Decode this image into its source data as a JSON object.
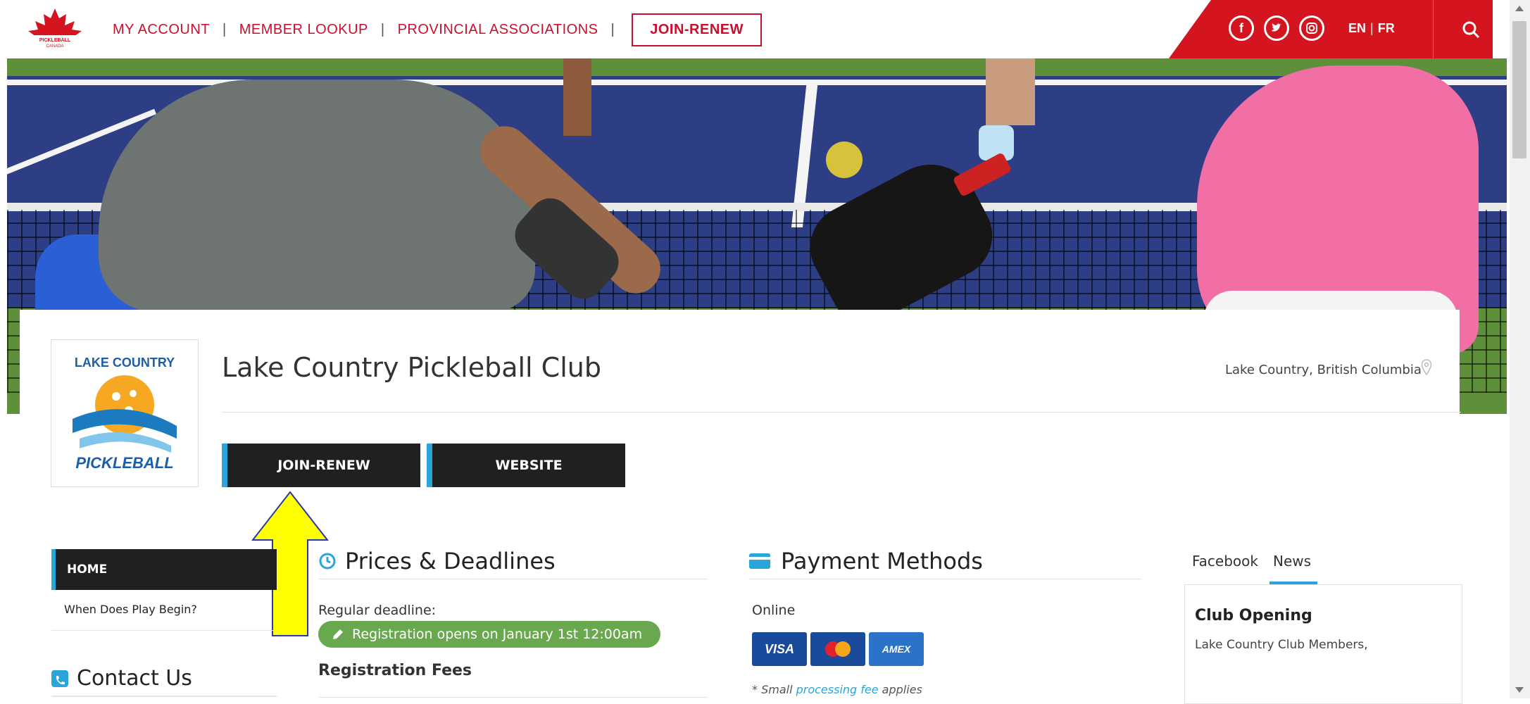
{
  "header": {
    "logo_text": "PICKLEBALL CANADA",
    "nav": [
      "MY ACCOUNT",
      "MEMBER LOOKUP",
      "PROVINCIAL ASSOCIATIONS"
    ],
    "separator": "|",
    "join_label": "JOIN-RENEW",
    "social_icons": [
      "facebook-icon",
      "twitter-icon",
      "instagram-icon"
    ],
    "lang_en": "EN",
    "lang_sep": "|",
    "lang_fr": "FR",
    "search_icon": "search-icon",
    "brand_red": "#d4141f"
  },
  "club": {
    "name": "Lake Country Pickleball Club",
    "location": "Lake Country, British Columbia",
    "logo_top": "LAKE COUNTRY",
    "logo_bottom": "PICKLEBALL",
    "buttons": {
      "join": "JOIN-RENEW",
      "website": "WEBSITE"
    },
    "accent": "#29a5db"
  },
  "sidebar": {
    "items": [
      {
        "label": "HOME",
        "active": true
      },
      {
        "label": "When Does Play Begin?",
        "active": false
      }
    ],
    "contact_title": "Contact Us"
  },
  "prices": {
    "title": "Prices & Deadlines",
    "regular_deadline_label": "Regular deadline:",
    "registration_badge": "Registration opens on January 1st 12:00am",
    "fees_title": "Registration Fees",
    "badge_color": "#6aa84f"
  },
  "payment": {
    "title": "Payment Methods",
    "online_label": "Online",
    "cards": [
      "VISA",
      "MasterCard",
      "AMEX"
    ],
    "note_prefix": "* Small ",
    "note_link": "processing fee",
    "note_suffix": " applies"
  },
  "news": {
    "tabs": [
      "Facebook",
      "News"
    ],
    "active_tab": "News",
    "item_title": "Club Opening",
    "item_text": "Lake Country Club Members,"
  },
  "annotation": {
    "arrow_color": "#ffff00"
  }
}
